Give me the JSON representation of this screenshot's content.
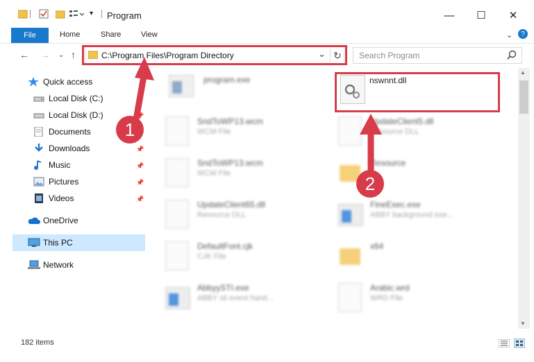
{
  "window": {
    "title": "Program",
    "minimize_glyph": "—",
    "maximize_glyph": "☐",
    "close_glyph": "✕"
  },
  "ribbon": {
    "tabs": [
      "File",
      "Home",
      "Share",
      "View"
    ],
    "help_glyph": "?"
  },
  "address": {
    "path": "C:\\Program Files\\Program Directory",
    "dropdown_glyph": "⌄",
    "refresh_glyph": "↻"
  },
  "search": {
    "placeholder": "Search Program",
    "icon": "search-icon"
  },
  "nav": {
    "back_glyph": "←",
    "forward_glyph": "→",
    "recent_glyph": "⌄",
    "up_glyph": "↑"
  },
  "sidebar": {
    "items": [
      {
        "label": "Quick access",
        "icon": "star-icon"
      },
      {
        "label": "Local Disk (C:)",
        "icon": "drive-icon"
      },
      {
        "label": "Local Disk (D:)",
        "icon": "drive-icon"
      },
      {
        "label": "Documents",
        "icon": "documents-icon"
      },
      {
        "label": "Downloads",
        "icon": "download-icon"
      },
      {
        "label": "Music",
        "icon": "music-icon"
      },
      {
        "label": "Pictures",
        "icon": "pictures-icon"
      },
      {
        "label": "Videos",
        "icon": "videos-icon"
      },
      {
        "label": "OneDrive",
        "icon": "cloud-icon"
      },
      {
        "label": "This PC",
        "icon": "computer-icon"
      },
      {
        "label": "Network",
        "icon": "network-icon"
      }
    ]
  },
  "files": {
    "highlighted": {
      "name": "nswnnt.dll"
    },
    "items": [
      {
        "name": "program.exe",
        "type": ""
      },
      {
        "name": "SndToWP13.wcm",
        "type": "WCM File"
      },
      {
        "name": "UpdateClient5.dll",
        "type": "Resource DLL"
      },
      {
        "name": "SndToWP13.wcm",
        "type": "WCM File"
      },
      {
        "name": "Resource",
        "type": ""
      },
      {
        "name": "UpdateClient65.dll",
        "type": "Resource DLL"
      },
      {
        "name": "FineExec.exe",
        "type": "ABBY background exe..."
      },
      {
        "name": "DefaultFont.cjk",
        "type": "CJK File"
      },
      {
        "name": "x64",
        "type": ""
      },
      {
        "name": "AbbyySTI.exe",
        "type": "ABBY sti event hand..."
      },
      {
        "name": "Arabic.wrd",
        "type": "WRD File"
      }
    ]
  },
  "status": {
    "count": "182 items"
  },
  "annotations": {
    "step1": "1",
    "step2": "2",
    "color": "#d83b4a"
  }
}
